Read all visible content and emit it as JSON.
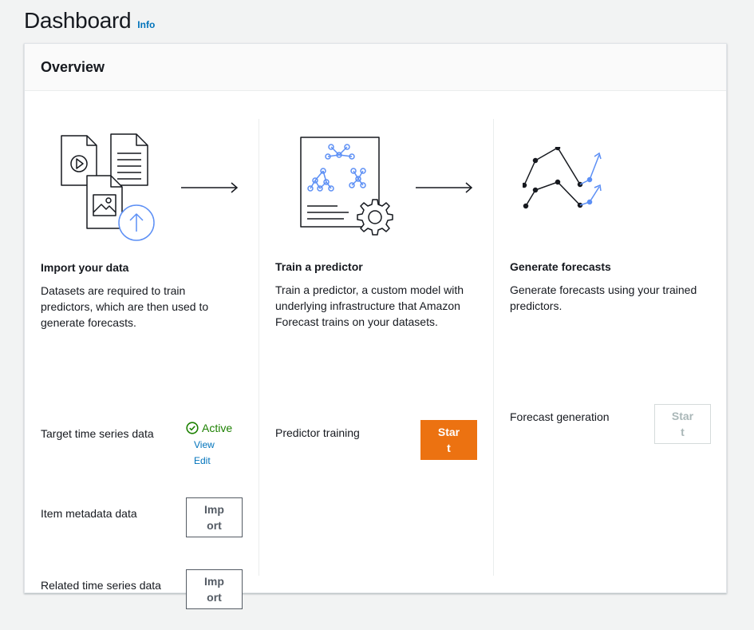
{
  "header": {
    "title": "Dashboard",
    "info_label": "Info"
  },
  "overview": {
    "title": "Overview",
    "import": {
      "title": "Import your data",
      "description": "Datasets are required to train predictors, which are then used to generate forecasts.",
      "rows": [
        {
          "label": "Target time series data",
          "status": "Active",
          "view_label": "View",
          "edit_label": "Edit"
        },
        {
          "label": "Item metadata data",
          "button_label": "Import"
        },
        {
          "label": "Related time series data",
          "button_label": "Import"
        }
      ]
    },
    "train": {
      "title": "Train a predictor",
      "description": "Train a predictor, a custom model with underlying infrastructure that Amazon Forecast trains on your datasets.",
      "row_label": "Predictor training",
      "button_label": "Start"
    },
    "generate": {
      "title": "Generate forecasts",
      "description": "Generate forecasts using your trained predictors.",
      "row_label": "Forecast generation",
      "button_label": "Start"
    }
  },
  "colors": {
    "accent_orange": "#ec7211",
    "link_blue": "#0073bb",
    "success_green": "#1d8102",
    "illustration_blue": "#5c8ff5"
  }
}
